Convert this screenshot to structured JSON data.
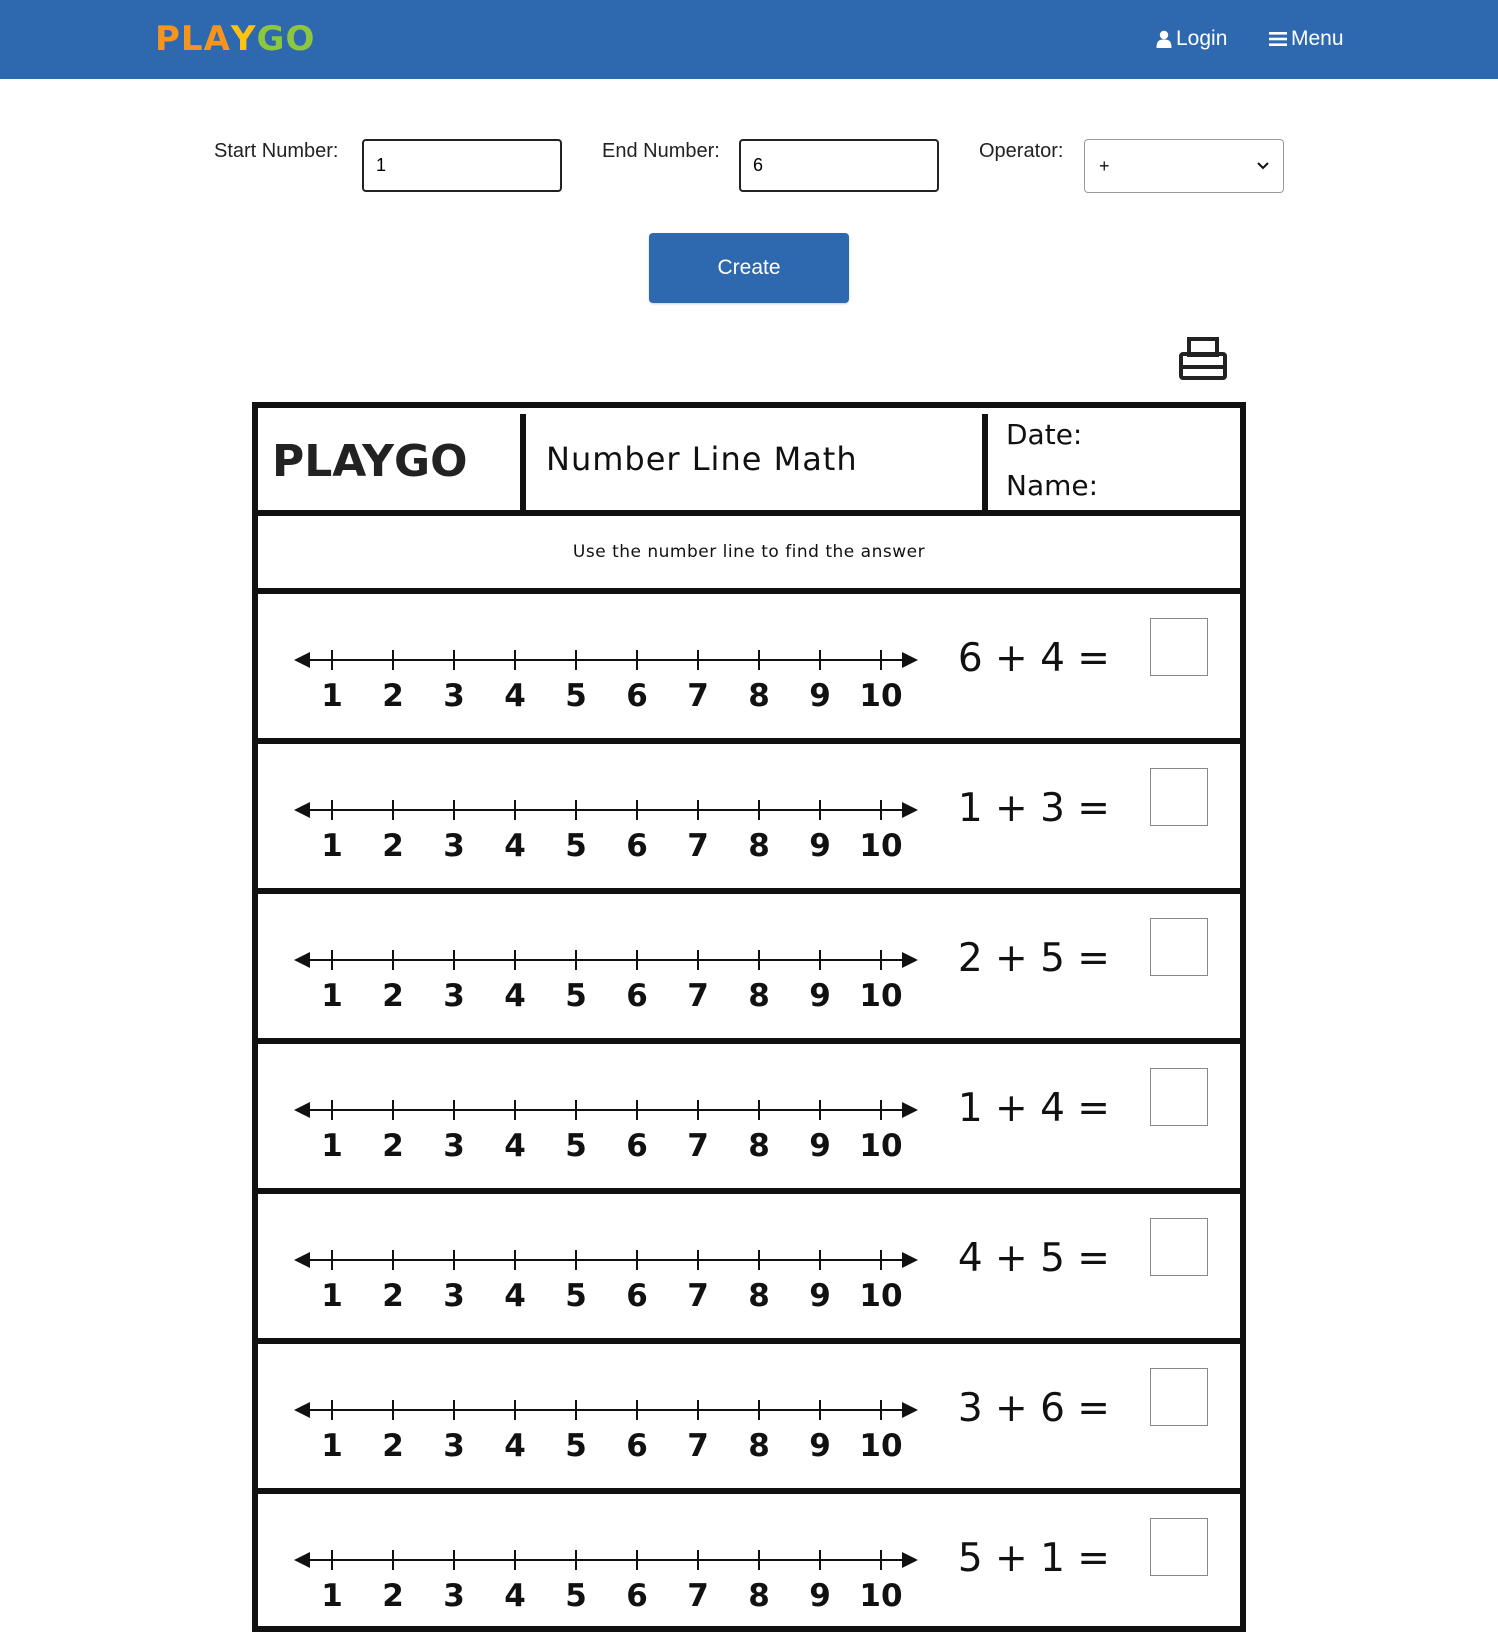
{
  "header": {
    "logo": [
      "P",
      "L",
      "A",
      "Y",
      "G",
      "O"
    ],
    "logo_colors": [
      "#f7941d",
      "#f7941d",
      "#f7941d",
      "#ffc20e",
      "#8dc63f",
      "#8dc63f"
    ],
    "login_label": "Login",
    "menu_label": "Menu",
    "bar_color": "#2e69b0"
  },
  "form": {
    "start_label": "Start Number:",
    "start_value": "1",
    "end_label": "End Number:",
    "end_value": "6",
    "operator_label": "Operator:",
    "operator_value": "+",
    "create_label": "Create"
  },
  "worksheet": {
    "logo": "PLAYGO",
    "title": "Number Line Math",
    "date_label": "Date:",
    "name_label": "Name:",
    "instruction": "Use the number line to find the answer",
    "number_line_ticks": [
      "1",
      "2",
      "3",
      "4",
      "5",
      "6",
      "7",
      "8",
      "9",
      "10"
    ],
    "problems": [
      {
        "a": "6",
        "op": "+",
        "b": "4",
        "eq": "="
      },
      {
        "a": "1",
        "op": "+",
        "b": "3",
        "eq": "="
      },
      {
        "a": "2",
        "op": "+",
        "b": "5",
        "eq": "="
      },
      {
        "a": "1",
        "op": "+",
        "b": "4",
        "eq": "="
      },
      {
        "a": "4",
        "op": "+",
        "b": "5",
        "eq": "="
      },
      {
        "a": "3",
        "op": "+",
        "b": "6",
        "eq": "="
      },
      {
        "a": "5",
        "op": "+",
        "b": "1",
        "eq": "="
      }
    ]
  }
}
